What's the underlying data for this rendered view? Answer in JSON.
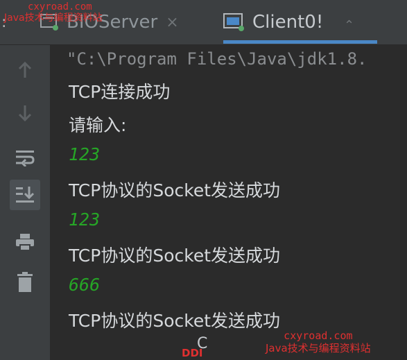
{
  "tabs": {
    "left_fragment": ":",
    "items": [
      {
        "label": "BIOServer",
        "close": "×",
        "icon": "document-run-icon",
        "active": false
      },
      {
        "label": "Client0!",
        "close": "",
        "icon": "console-run-icon",
        "active": true
      }
    ],
    "overflow": "⌃",
    "active_color": "#4a88c7"
  },
  "gutter": {
    "icons": [
      "up-arrow-icon",
      "down-arrow-icon",
      "soft-wrap-icon",
      "scroll-to-end-icon",
      "print-icon",
      "trash-icon"
    ]
  },
  "console": {
    "command": "\"C:\\Program Files\\Java\\jdk1.8.",
    "lines": [
      {
        "text": "TCP连接成功",
        "type": "output"
      },
      {
        "text": "请输入:",
        "type": "output"
      },
      {
        "text": "123",
        "type": "input"
      },
      {
        "text": "TCP协议的Socket发送成功",
        "type": "output"
      },
      {
        "text": "123",
        "type": "input"
      },
      {
        "text": "TCP协议的Socket发送成功",
        "type": "output"
      },
      {
        "text": "666",
        "type": "input"
      },
      {
        "text": "TCP协议的Socket发送成功",
        "type": "output"
      }
    ],
    "input_color": "#26a626"
  },
  "watermarks": {
    "top_url": "cxyroad.com",
    "top_text": "Java技术与编程资料站",
    "bottom_url": "cxyroad.com",
    "bottom_text": "Java技术与编程资料站",
    "bottom_ddi": "DDI",
    "bottom_c": "C"
  }
}
